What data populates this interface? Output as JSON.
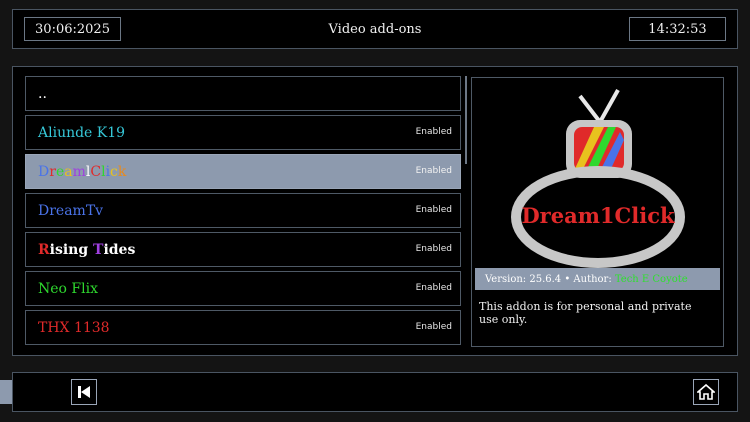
{
  "header": {
    "date": "30:06:2025",
    "title": "Video add-ons",
    "time": "14:32:53"
  },
  "list": {
    "items": [
      {
        "label": "..",
        "status": "",
        "color": "#ffffff"
      },
      {
        "label": "Aliunde K19",
        "status": "Enabled",
        "color": "#36c8d8"
      },
      {
        "label": "DreamlClick",
        "status": "Enabled",
        "color": "multicolor",
        "selected": true
      },
      {
        "label": "DreamTv",
        "status": "Enabled",
        "color": "#4a73e8"
      },
      {
        "label": "Rising Tides",
        "status": "Enabled",
        "color": "#ffffff"
      },
      {
        "label": "Neo Flix",
        "status": "Enabled",
        "color": "#2ed82e"
      },
      {
        "label": "THX 1138",
        "status": "Enabled",
        "color": "#e02a2a"
      }
    ]
  },
  "detail": {
    "logo_text": "Dream1Click",
    "version_prefix": "Version: 25.6.4 • Author:",
    "author": "Tech E Coyote",
    "description": "This addon is for personal and private use only."
  },
  "footer": {
    "back_icon": "chevron-left-icon",
    "skip_icon": "skip-back-icon",
    "home_icon": "home-icon"
  },
  "colors": {
    "selected": "#8d9aae",
    "border": "#4e5966",
    "background": "#000000"
  }
}
